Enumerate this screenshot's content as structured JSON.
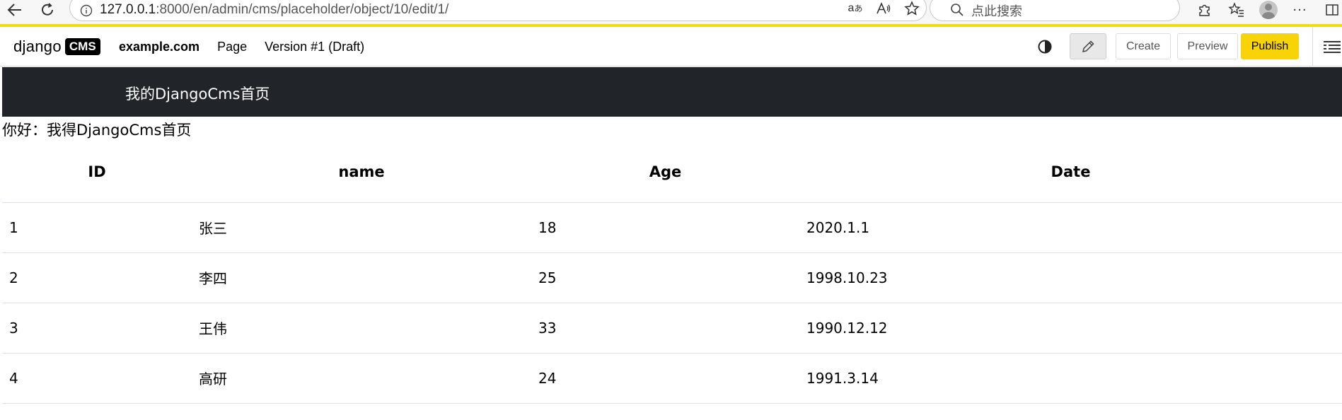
{
  "browser": {
    "url_host": "127.0.0.1",
    "url_rest": ":8000/en/admin/cms/placeholder/object/10/edit/1/",
    "search_placeholder": "点此搜索",
    "read_aloud_glyph": "Aᴬ",
    "translate_glyph": "aあ"
  },
  "cms_toolbar": {
    "logo_word": "django",
    "logo_badge": "CMS",
    "menu": [
      {
        "label": "example.com"
      },
      {
        "label": "Page"
      },
      {
        "label": "Version #1 (Draft)"
      }
    ],
    "buttons": {
      "create": "Create",
      "preview": "Preview",
      "publish": "Publish"
    },
    "publish_color": "#f8d406"
  },
  "page": {
    "hero_title": "我的DjangoCms首页",
    "hero_background": "#212529",
    "greeting": "你好：我得DjangoCms首页",
    "table": {
      "headers": [
        "ID",
        "name",
        "Age",
        "Date"
      ],
      "rows": [
        [
          "1",
          "张三",
          "18",
          "2020.1.1"
        ],
        [
          "2",
          "李四",
          "25",
          "1998.10.23"
        ],
        [
          "3",
          "王伟",
          "33",
          "1990.12.12"
        ],
        [
          "4",
          "高研",
          "24",
          "1991.3.14"
        ]
      ]
    }
  }
}
